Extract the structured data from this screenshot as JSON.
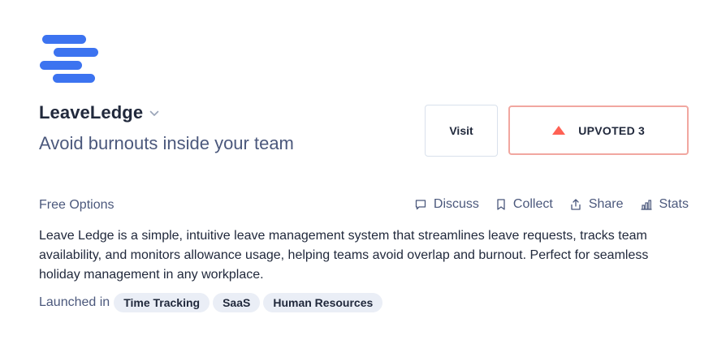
{
  "product": {
    "logo_icon": "stacked-lines-logo",
    "name": "LeaveLedge",
    "tagline": "Avoid burnouts inside your team",
    "menu_icon": "chevron-down-icon"
  },
  "buttons": {
    "visit_label": "Visit",
    "upvote_label": "UPVOTED",
    "upvote_count": "3",
    "upvote_icon": "triangle-up-icon"
  },
  "pricing": "Free Options",
  "actions": [
    {
      "label": "Discuss",
      "icon": "comment-icon"
    },
    {
      "label": "Collect",
      "icon": "bookmark-icon"
    },
    {
      "label": "Share",
      "icon": "share-icon"
    },
    {
      "label": "Stats",
      "icon": "bar-chart-icon"
    }
  ],
  "description": "Leave Ledge is a simple, intuitive leave management system that streamlines leave requests, tracks team availability, and monitors allowance usage, helping teams avoid overlap and burnout. Perfect for seamless holiday management in any workplace.",
  "launched": {
    "label": "Launched in",
    "tags": [
      "Time Tracking",
      "SaaS",
      "Human Resources"
    ]
  },
  "colors": {
    "accent": "#3c73f0",
    "upvote": "#ff6154",
    "upvote_border": "#f1a7a0",
    "text_primary": "#21293c",
    "text_secondary": "#4b587c",
    "tag_bg": "#eaeef6"
  }
}
